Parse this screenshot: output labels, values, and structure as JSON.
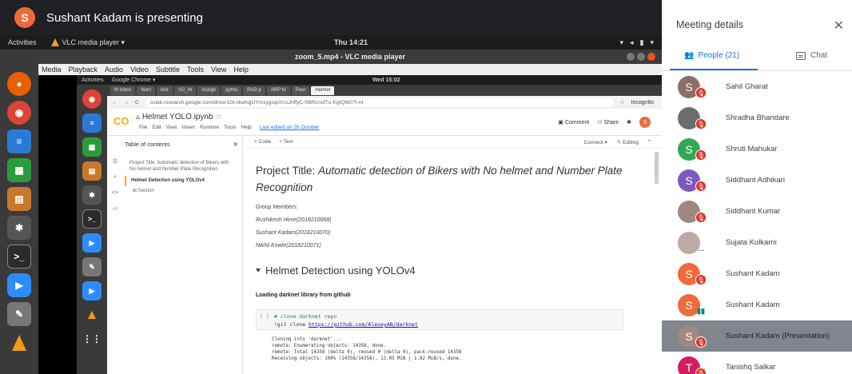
{
  "presenter": {
    "initial": "S",
    "text": "Sushant Kadam is presenting"
  },
  "ubuntu": {
    "activities": "Activities",
    "app": "VLC media player ▾",
    "clock": "Thu 14:21"
  },
  "vlc": {
    "title": "zoom_5.mp4 - VLC media player",
    "menu": [
      "Media",
      "Playback",
      "Audio",
      "Video",
      "Subtitle",
      "Tools",
      "View",
      "Help"
    ]
  },
  "inner_ubuntu": {
    "activities": "Activities",
    "app": "Google Chrome ▾",
    "clock": "Wed 15:02"
  },
  "chrome": {
    "tabs": [
      "M Inbox",
      "Num",
      "test",
      "VG_W",
      "Assign",
      "pytho",
      "RAD p",
      "ARP fo",
      "Peer",
      "Helmet"
    ],
    "url": "colab.research.google.com/drive/1Gi-xkehqjUYm1ygsqoVcsJnffyC-RBRcnsfTu-KgIQMzI?i-nt",
    "incognito": "Incognito"
  },
  "colab": {
    "logo": "CO",
    "title": "Helmet YOLO.ipynb",
    "menu": [
      "File",
      "Edit",
      "View",
      "Insert",
      "Runtime",
      "Tools",
      "Help"
    ],
    "last_edited": "Last edited on 26 October",
    "comment": "Comment",
    "share": "Share",
    "avatar": "S",
    "connect": "Connect ▾",
    "editing": "Editing",
    "toolbar_code": "+ Code",
    "toolbar_text": "+ Text"
  },
  "toc": {
    "heading": "Table of contents",
    "items": [
      "Project Title: Automatic detection of Bikers with No helmet and Number Plate Recognition",
      "Helmet Detection using YOLOv4",
      "Section"
    ]
  },
  "notebook": {
    "title_label": "Project Title:",
    "title_rest": "Automatic detection of Bikers with No helmet and Number Plate Recognition",
    "group_members": "Group Members:",
    "members": [
      "Rushikesh Hirve(2018210068)",
      "Sushant Kadam(2018210070)",
      "Nikhil Kowle(2018210071)"
    ],
    "section": "Helmet Detection using YOLOv4",
    "loading": "Loading darknet library from github",
    "cell_bracket": "[ ]",
    "code_comment": "# clone darknet repo",
    "code_cmd": "!git clone ",
    "code_link": "https://github.com/AlexeyAB/darknet",
    "output": [
      "Cloning into 'darknet'...",
      "remote: Enumerating objects: 14358, done.",
      "remote: Total 14358 (delta 0), reused 0 (delta 0), pack-reused 14358",
      "Receiving objects: 100% (14358/14358), 13.05 MiB | 1.82 MiB/s, done."
    ]
  },
  "panel": {
    "title": "Meeting details",
    "tab_people": "People (21)",
    "tab_chat": "Chat",
    "people": [
      {
        "name": "Sahil Gharat",
        "initial": "S",
        "color": "#8d6e63",
        "status": "muted"
      },
      {
        "name": "Shradha Bhandare",
        "initial": "",
        "color": "#6d6d6d",
        "status": "muted"
      },
      {
        "name": "Shruti Mahukar",
        "initial": "S",
        "color": "#33a852",
        "status": "muted"
      },
      {
        "name": "Siddhant Adhikari",
        "initial": "S",
        "color": "#7e57c2",
        "status": "muted"
      },
      {
        "name": "Siddhant Kumar",
        "initial": "",
        "color": "#a1887f",
        "status": "muted"
      },
      {
        "name": "Sujata Kulkarni",
        "initial": "",
        "color": "#bcaaa4",
        "status": "idle"
      },
      {
        "name": "Sushant Kadam",
        "initial": "S",
        "color": "#ee6a3b",
        "status": "muted"
      },
      {
        "name": "Sushant Kadam",
        "initial": "S",
        "color": "#ee6a3b",
        "status": "talking"
      },
      {
        "name": "Sushant Kadam (Presentation)",
        "initial": "S",
        "color": "#a1887f",
        "status": "muted"
      },
      {
        "name": "Tanishq Salkar",
        "initial": "T",
        "color": "#d81b60",
        "status": "muted"
      }
    ]
  },
  "colors": {
    "accent": "#1a73e8",
    "mute_red": "#d93025",
    "colab_orange": "#f9ab00"
  }
}
